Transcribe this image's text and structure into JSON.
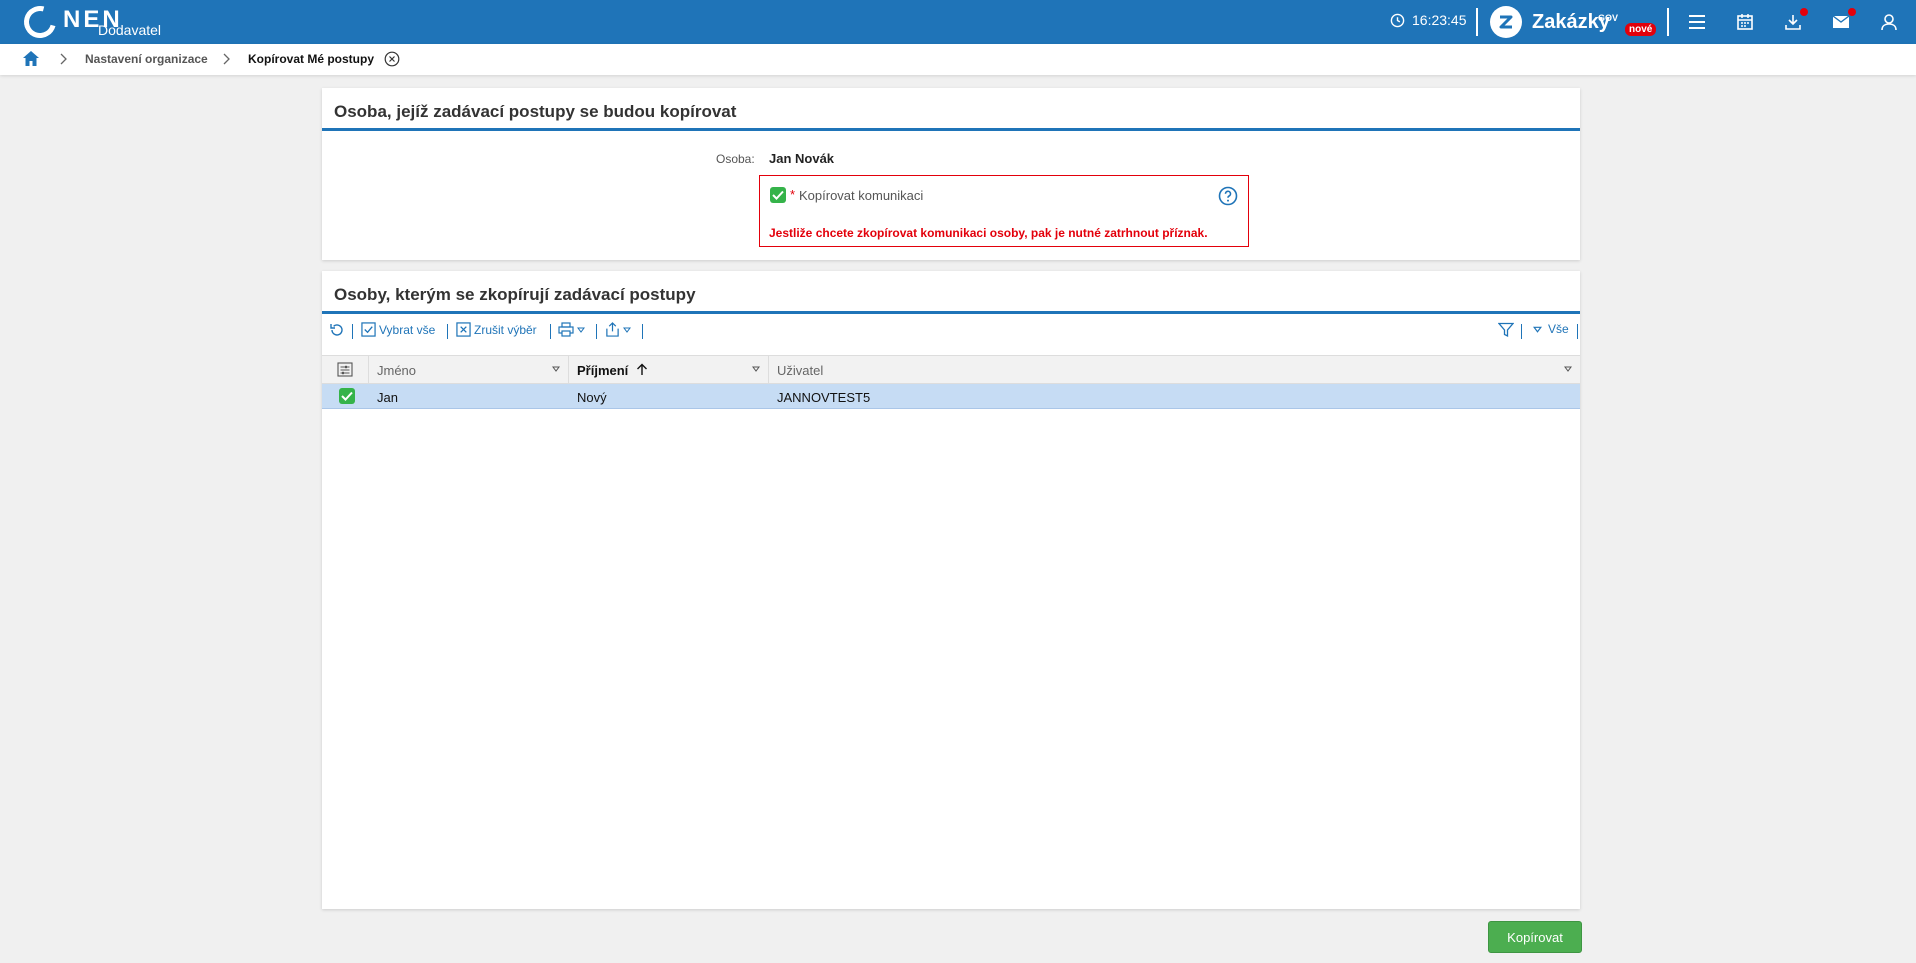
{
  "header": {
    "logo_text": "NEN",
    "logo_sub": "Dodavatel",
    "time": "16:23:45",
    "zakazky_label": "Zakázky",
    "zakazky_gov": "GOV",
    "zakazky_badge": "nové"
  },
  "breadcrumb": {
    "items": [
      "Nastavení organizace",
      "Kopírovat Mé postupy"
    ]
  },
  "panel1": {
    "title": "Osoba, jejíž zadávací postupy se budou kopírovat",
    "osoba_label": "Osoba:",
    "osoba_value": "Jan Novák",
    "checkbox_required": "*",
    "checkbox_label": "Kopírovat komunikaci",
    "warning": "Jestliže chcete zkopírovat komunikaci osoby, pak je nutné zatrhnout příznak."
  },
  "panel2": {
    "title": "Osoby, kterým se zkopírují zadávací postupy",
    "toolbar": {
      "select_all": "Vybrat vše",
      "cancel_selection": "Zrušit výběr",
      "filter_all": "Vše"
    },
    "columns": [
      "Jméno",
      "Příjmení",
      "Uživatel"
    ],
    "rows": [
      {
        "jmeno": "Jan",
        "prijmeni": "Nový",
        "uzivatel": "JANNOVTEST5"
      }
    ]
  },
  "footer": {
    "copy_button": "Kopírovat"
  },
  "colors": {
    "primary": "#1f74b8",
    "success": "#4cae50",
    "error": "#e3000b",
    "selected_row": "#c6dcf4"
  }
}
